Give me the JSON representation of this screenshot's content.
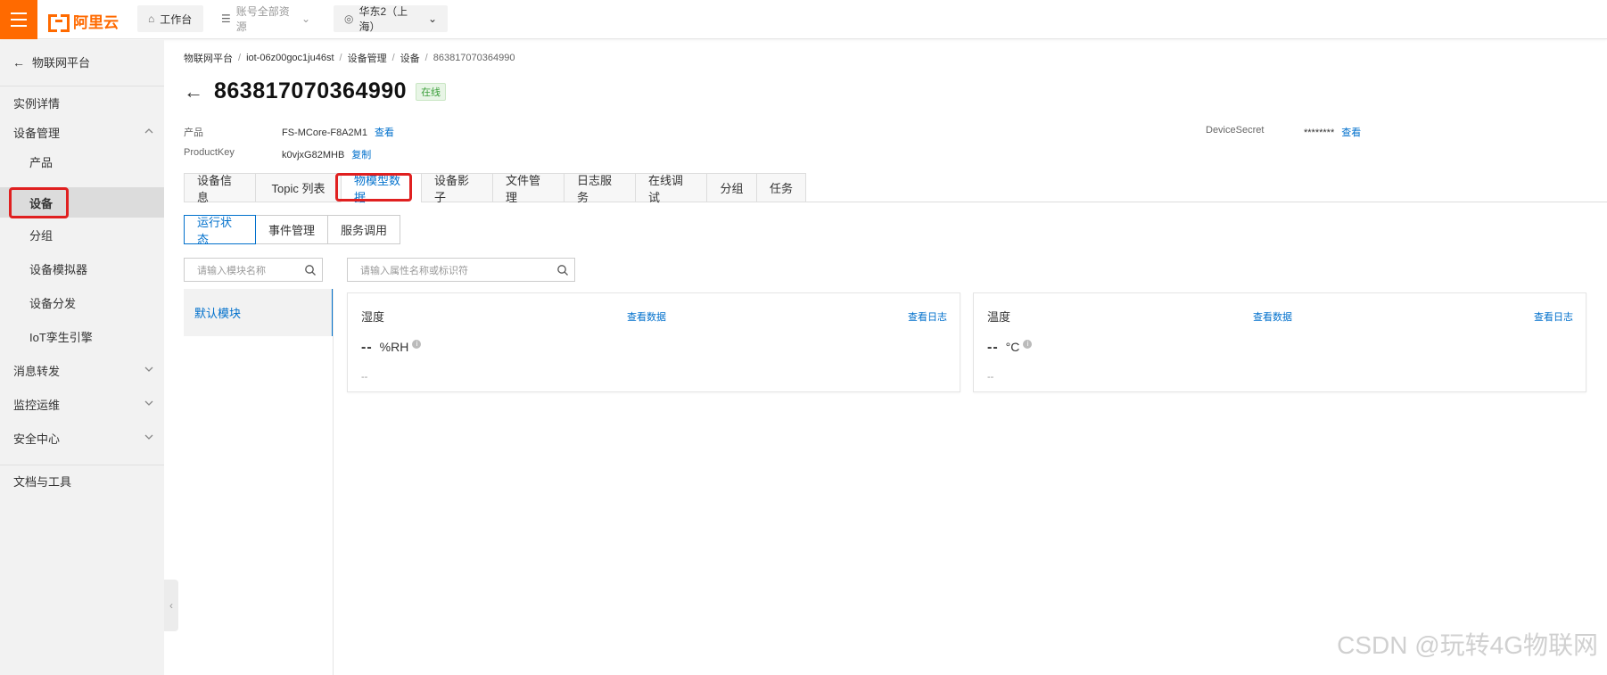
{
  "topbar": {
    "logo_text": "阿里云",
    "workbench": "工作台",
    "resources": "账号全部资源",
    "region": "华东2（上海）"
  },
  "sidebar": {
    "back_label": "物联网平台",
    "items": [
      {
        "label": "实例详情"
      },
      {
        "label": "设备管理"
      },
      {
        "label": "产品"
      },
      {
        "label": "设备"
      },
      {
        "label": "分组"
      },
      {
        "label": "设备模拟器"
      },
      {
        "label": "设备分发"
      },
      {
        "label": "IoT孪生引擎"
      },
      {
        "label": "消息转发"
      },
      {
        "label": "监控运维"
      },
      {
        "label": "安全中心"
      },
      {
        "label": "文档与工具"
      }
    ]
  },
  "breadcrumb": [
    "物联网平台",
    "iot-06z00goc1ju46st",
    "设备管理",
    "设备",
    "863817070364990"
  ],
  "device": {
    "title": "863817070364990",
    "status": "在线",
    "product_label": "产品",
    "product_value": "FS-MCore-F8A2M1",
    "product_link": "查看",
    "productkey_label": "ProductKey",
    "productkey_value": "k0vjxG82MHB",
    "productkey_link": "复制",
    "secret_label": "DeviceSecret",
    "secret_value": "********",
    "secret_link": "查看"
  },
  "tabs": [
    "设备信息",
    "Topic 列表",
    "物模型数据",
    "设备影子",
    "文件管理",
    "日志服务",
    "在线调试",
    "分组",
    "任务"
  ],
  "subtabs": [
    "运行状态",
    "事件管理",
    "服务调用"
  ],
  "module_search_placeholder": "请输入模块名称",
  "property_search_placeholder": "请输入属性名称或标识符",
  "modules": [
    "默认模块"
  ],
  "cards": [
    {
      "name": "湿度",
      "link_data": "查看数据",
      "link_log": "查看日志",
      "value": "--",
      "unit": "%RH",
      "time": "--"
    },
    {
      "name": "温度",
      "link_data": "查看数据",
      "link_log": "查看日志",
      "value": "--",
      "unit": "°C",
      "time": "--"
    }
  ],
  "watermark": "CSDN @玩转4G物联网",
  "colors": {
    "brand": "#ff6a00",
    "link": "#0070cc",
    "highlight": "#e02020",
    "online": "#3a9e3a"
  }
}
